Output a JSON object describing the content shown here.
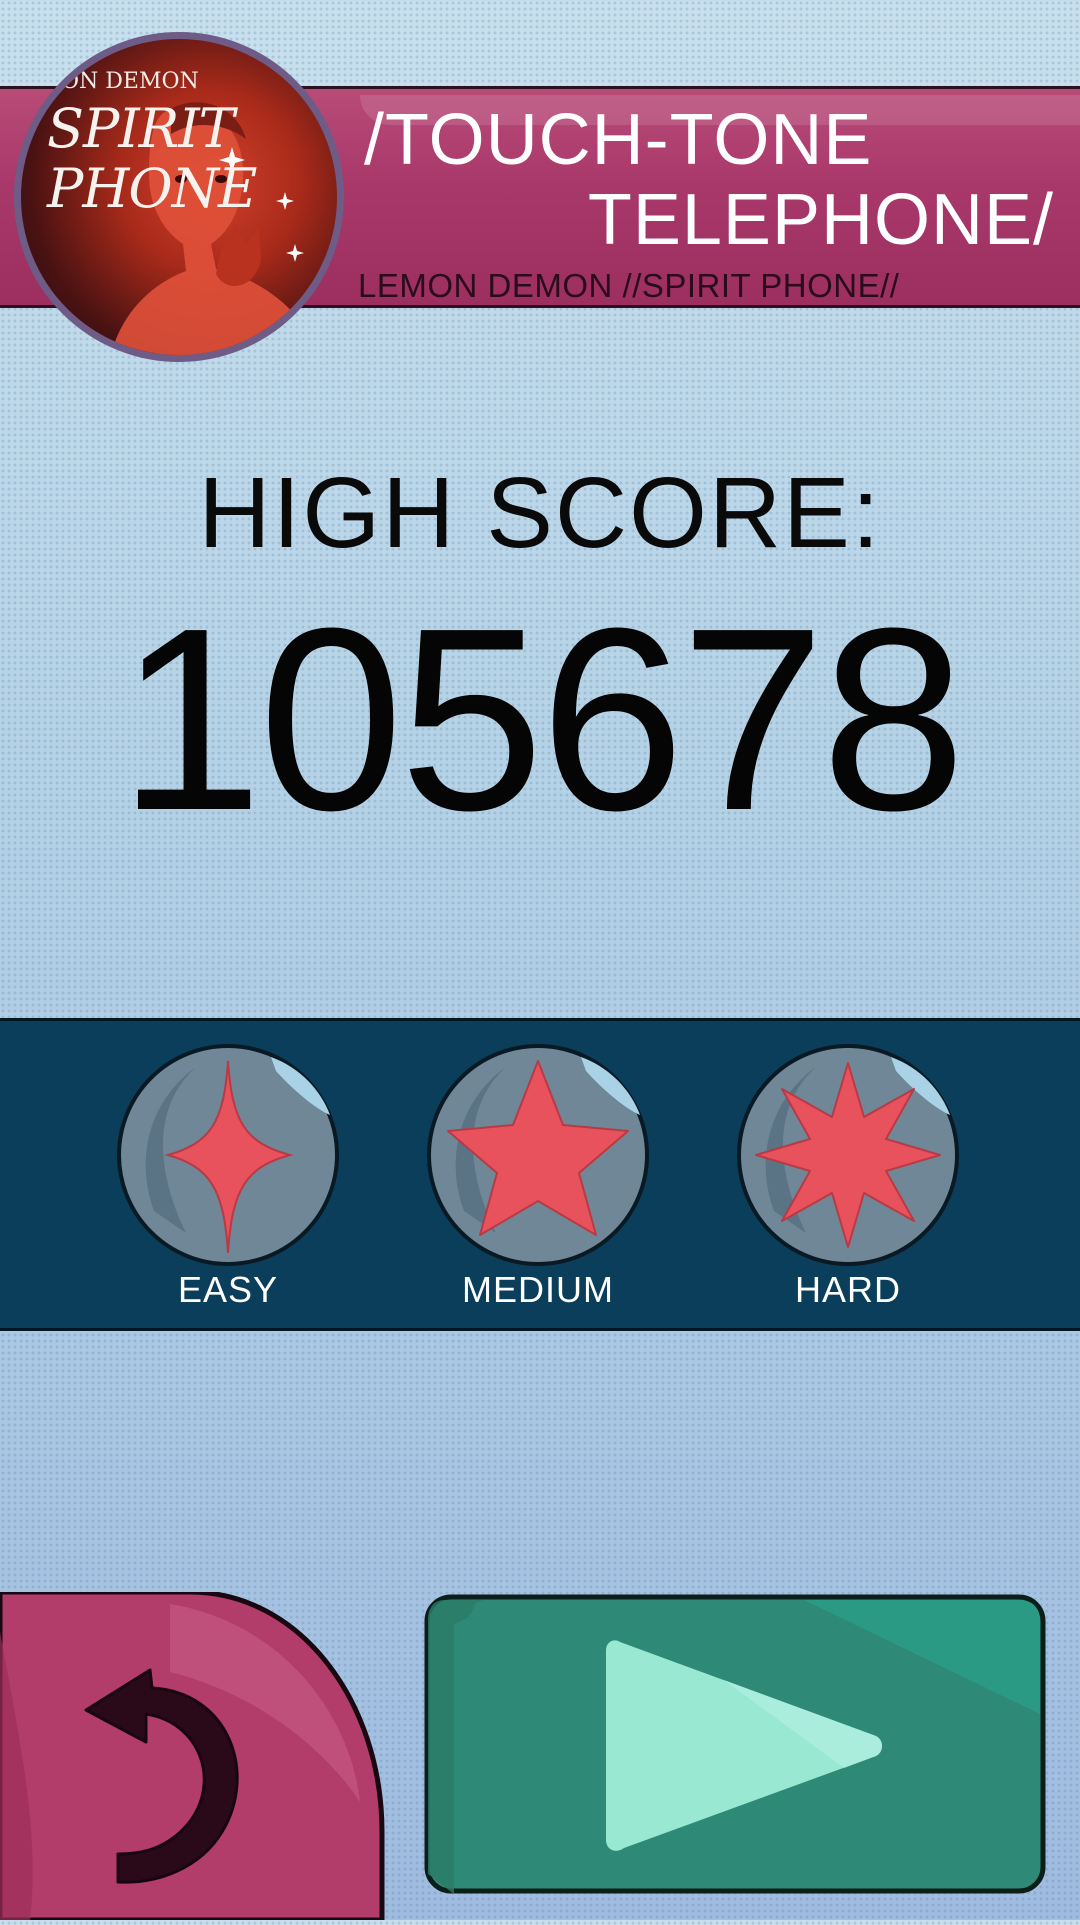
{
  "header": {
    "album_art": {
      "artist_text": "ON DEMON",
      "title_line1": "SPIRIT",
      "title_line2": "PHONE"
    },
    "song_title_line1": "/TOUCH-TONE",
    "song_title_line2": "TELEPHONE/",
    "artist_album": "LEMON DEMON //SPIRIT PHONE//"
  },
  "score": {
    "label": "HIGH SCORE:",
    "value": "105678"
  },
  "difficulty": {
    "options": [
      {
        "label": "EASY",
        "icon": "four-point-star-icon"
      },
      {
        "label": "MEDIUM",
        "icon": "five-point-star-icon"
      },
      {
        "label": "HARD",
        "icon": "eight-point-star-icon"
      }
    ]
  },
  "controls": {
    "back_icon": "undo-arrow-icon",
    "play_icon": "play-icon"
  },
  "colors": {
    "banner": "#a8386a",
    "difficulty_strip": "#0b3e5a",
    "star": "#e8525c",
    "back_button": "#b23c6a",
    "play_button": "#2e8a76",
    "play_triangle": "#98e8d2"
  }
}
